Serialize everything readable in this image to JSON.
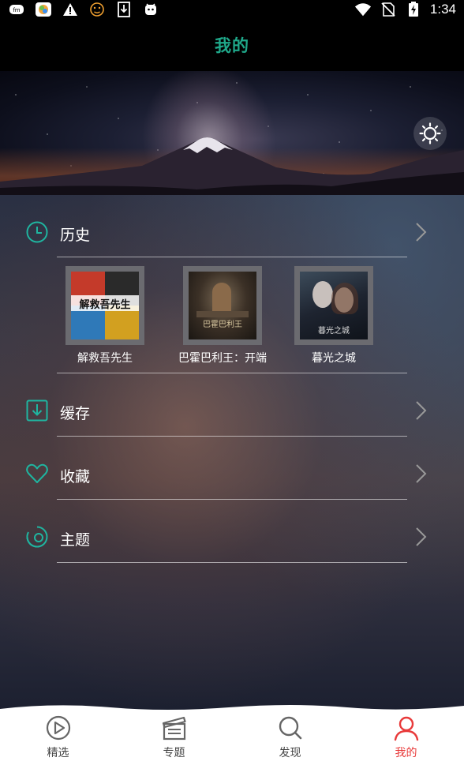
{
  "status_bar": {
    "time": "1:34",
    "left_icons": [
      "app-icon-1",
      "app-icon-2",
      "warning-icon",
      "face-icon",
      "download-icon",
      "android-icon"
    ],
    "right_icons": [
      "wifi-icon",
      "no-sim-icon",
      "battery-charging-icon"
    ]
  },
  "header": {
    "title": "我的"
  },
  "colors": {
    "accent": "#1fa88a",
    "active_tab": "#e83a3a"
  },
  "menu": {
    "history": {
      "label": "历史",
      "icon": "clock-icon"
    },
    "cache": {
      "label": "缓存",
      "icon": "download-box-icon"
    },
    "favorites": {
      "label": "收藏",
      "icon": "heart-icon"
    },
    "theme": {
      "label": "主题",
      "icon": "theme-icon"
    }
  },
  "history_items": [
    {
      "title": "解救吾先生",
      "poster_text": "解救吾先生"
    },
    {
      "title": "巴霍巴利王：开端",
      "poster_text": "巴霍巴利王"
    },
    {
      "title": "暮光之城",
      "poster_text": "暮光之城"
    }
  ],
  "bottom_nav": [
    {
      "label": "精选",
      "icon": "play-circle-icon",
      "active": false
    },
    {
      "label": "专题",
      "icon": "clapperboard-icon",
      "active": false
    },
    {
      "label": "发现",
      "icon": "search-icon",
      "active": false
    },
    {
      "label": "我的",
      "icon": "person-icon",
      "active": true
    }
  ]
}
